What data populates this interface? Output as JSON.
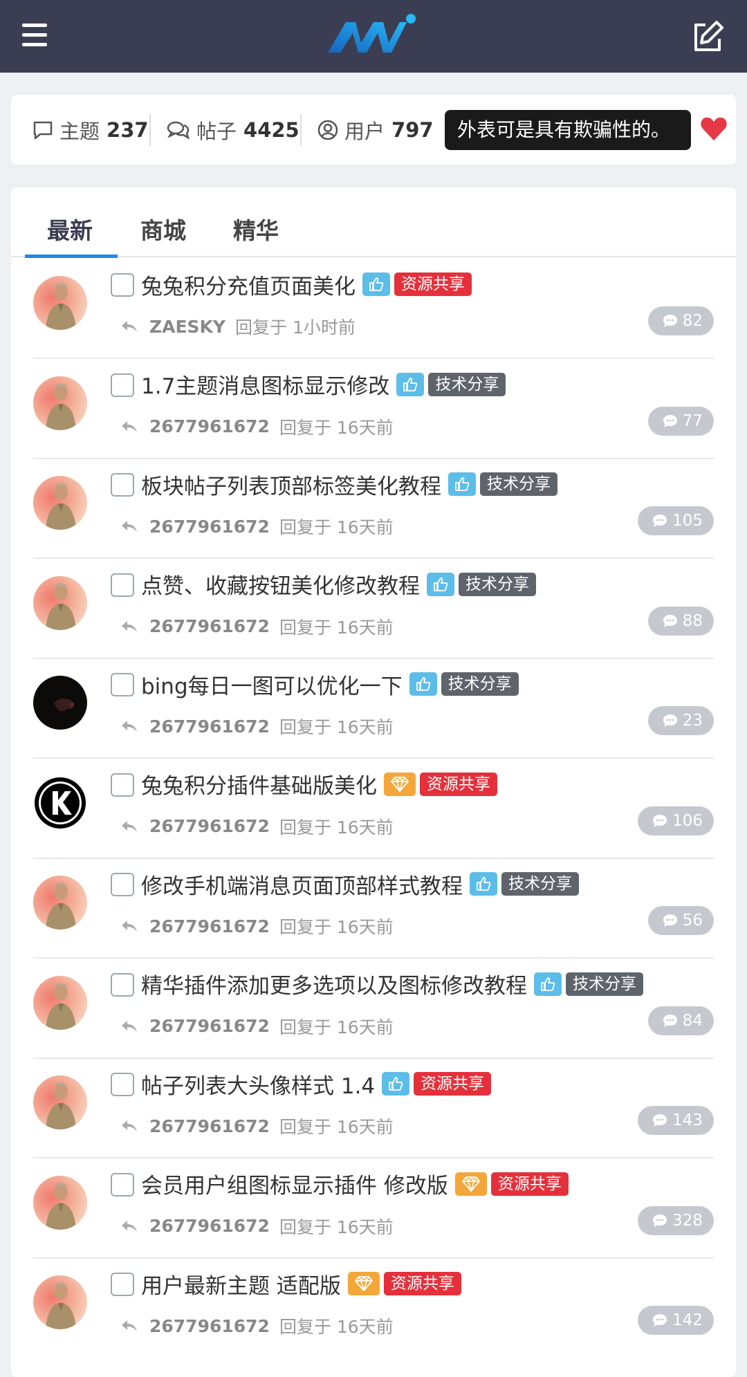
{
  "stats": {
    "topics_label": "主题",
    "topics_value": "237",
    "posts_label": "帖子",
    "posts_value": "4425",
    "users_label": "用户",
    "users_value": "797",
    "tooltip": "外表可是具有欺骗性的。"
  },
  "tabs": [
    "最新",
    "商城",
    "精华"
  ],
  "reply_text": "回复于",
  "colors": {
    "topbar": "#3b3e52",
    "accent": "#1e88e5",
    "tag_red": "#e5303b",
    "tag_gray": "#5f646c",
    "like": "#5bbde8",
    "gem": "#f3a73a",
    "heart": "#e53945"
  },
  "posts": [
    {
      "title": "兔兔积分充值页面美化",
      "badge": "like-icon",
      "tag": "资源共享",
      "user": "ZAESKY",
      "reply": "回复于 1小时前",
      "count": "82",
      "avatar": "photo"
    },
    {
      "title": "1.7主题消息图标显示修改",
      "badge": "like-icon",
      "tag": "技术分享",
      "user": "2677961672",
      "reply": "回复于 16天前",
      "count": "77",
      "avatar": "photo"
    },
    {
      "title": "板块帖子列表顶部标签美化教程",
      "badge": "like-icon",
      "tag": "技术分享",
      "user": "2677961672",
      "reply": "回复于 16天前",
      "count": "105",
      "avatar": "photo"
    },
    {
      "title": "点赞、收藏按钮美化修改教程",
      "badge": "like-icon",
      "tag": "技术分享",
      "user": "2677961672",
      "reply": "回复于 16天前",
      "count": "88",
      "avatar": "photo"
    },
    {
      "title": "bing每日一图可以优化一下",
      "badge": "like-icon",
      "tag": "技术分享",
      "user": "2677961672",
      "reply": "回复于 16天前",
      "count": "23",
      "avatar": "dark"
    },
    {
      "title": "兔兔积分插件基础版美化",
      "badge": "gem-icon",
      "tag": "资源共享",
      "user": "2677961672",
      "reply": "回复于 16天前",
      "count": "106",
      "avatar": "k-logo"
    },
    {
      "title": "修改手机端消息页面顶部样式教程",
      "badge": "like-icon",
      "tag": "技术分享",
      "user": "2677961672",
      "reply": "回复于 16天前",
      "count": "56",
      "avatar": "photo"
    },
    {
      "title": "精华插件添加更多选项以及图标修改教程",
      "badge": "like-icon",
      "tag": "技术分享",
      "user": "2677961672",
      "reply": "回复于 16天前",
      "count": "84",
      "avatar": "photo"
    },
    {
      "title": "帖子列表大头像样式 1.4",
      "badge": "like-icon",
      "tag": "资源共享",
      "user": "2677961672",
      "reply": "回复于 16天前",
      "count": "143",
      "avatar": "photo"
    },
    {
      "title": "会员用户组图标显示插件 修改版",
      "badge": "gem-icon",
      "tag": "资源共享",
      "user": "2677961672",
      "reply": "回复于 16天前",
      "count": "328",
      "avatar": "photo"
    },
    {
      "title": "用户最新主题 适配版",
      "badge": "gem-icon",
      "tag": "资源共享",
      "user": "2677961672",
      "reply": "回复于 16天前",
      "count": "142",
      "avatar": "photo"
    }
  ]
}
